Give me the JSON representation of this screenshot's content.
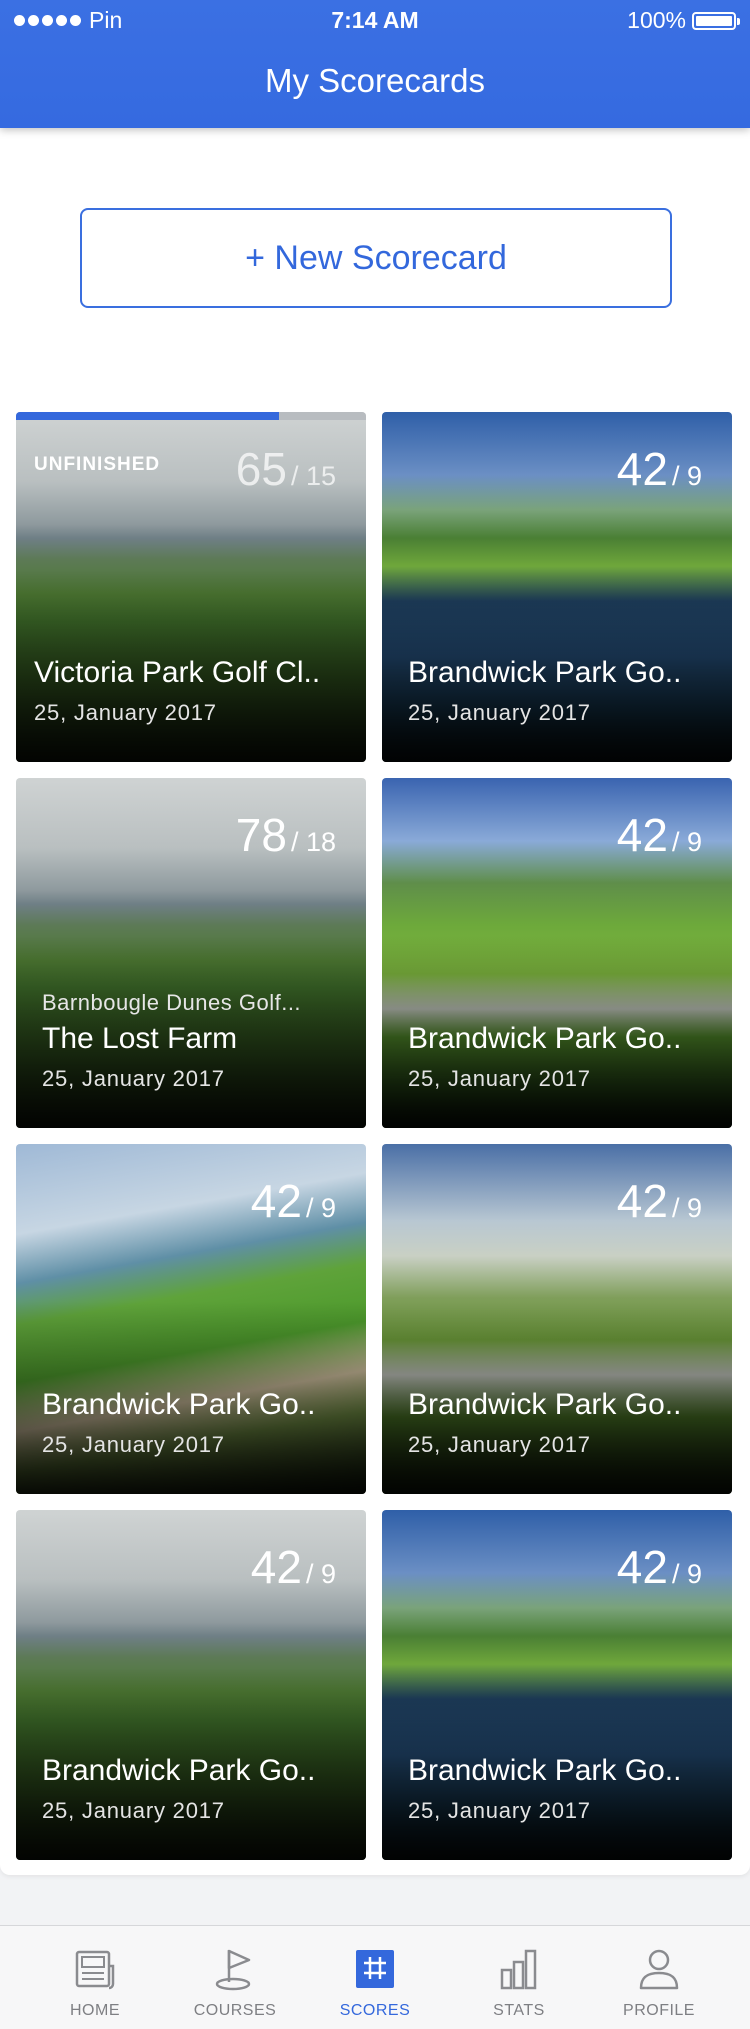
{
  "status_bar": {
    "carrier": "Pin",
    "time": "7:14 AM",
    "battery": "100%"
  },
  "header": {
    "title": "My Scorecards"
  },
  "new_button": {
    "label": "+ New Scorecard"
  },
  "cards": [
    {
      "badge": "UNFINISHED",
      "progress": 0.75,
      "score": "65",
      "par": "/ 15",
      "name": "Victoria Park Golf Cl..",
      "date": "25, January 2017"
    },
    {
      "score": "42",
      "par": "/ 9",
      "name": "Brandwick Park Go..",
      "date": "25, January 2017"
    },
    {
      "score": "78",
      "par": "/ 18",
      "subtitle": "Barnbougle Dunes Golf...",
      "name": "The Lost Farm",
      "date": "25, January 2017"
    },
    {
      "score": "42",
      "par": "/ 9",
      "name": "Brandwick Park Go..",
      "date": "25, January 2017"
    },
    {
      "score": "42",
      "par": "/ 9",
      "name": "Brandwick Park Go..",
      "date": "25, January 2017"
    },
    {
      "score": "42",
      "par": "/ 9",
      "name": "Brandwick Park Go..",
      "date": "25, January 2017"
    },
    {
      "score": "42",
      "par": "/ 9",
      "name": "Brandwick Park Go..",
      "date": "25, January 2017"
    },
    {
      "score": "42",
      "par": "/ 9",
      "name": "Brandwick Park Go..",
      "date": "25, January 2017"
    }
  ],
  "tabs": [
    {
      "label": "HOME",
      "icon": "home-icon"
    },
    {
      "label": "COURSES",
      "icon": "flag-icon"
    },
    {
      "label": "SCORES",
      "icon": "scorecard-icon",
      "active": true
    },
    {
      "label": "STATS",
      "icon": "bar-chart-icon"
    },
    {
      "label": "PROFILE",
      "icon": "person-icon"
    }
  ],
  "colors": {
    "primary": "#3468dc",
    "tab_inactive": "#7e7f83"
  }
}
